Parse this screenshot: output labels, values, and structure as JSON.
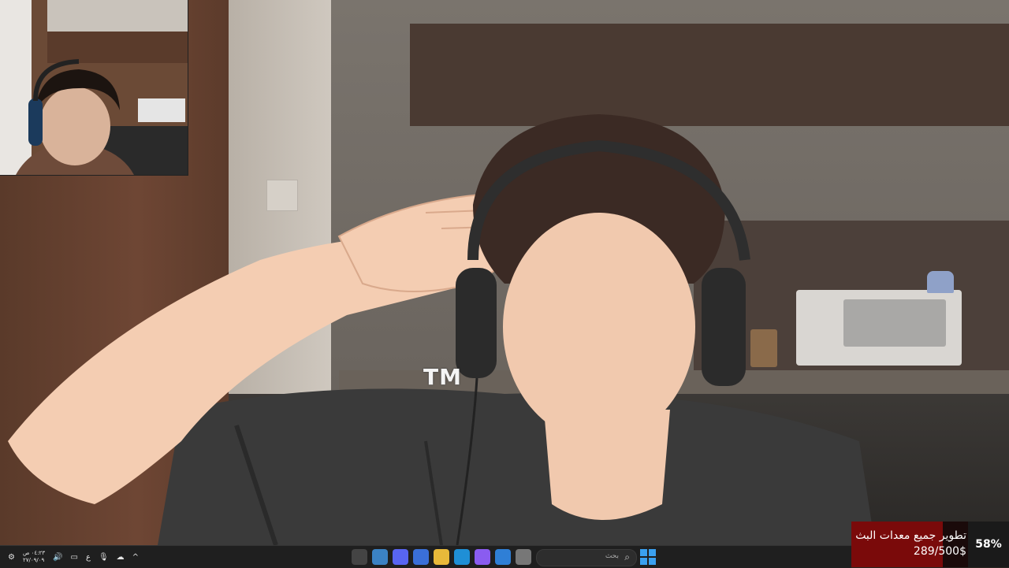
{
  "overlay": {
    "watermark": "TM"
  },
  "goal": {
    "title": "تطوير جميع معدات البث",
    "amount": "289/500$",
    "percent_label": "58%",
    "progress": 0.58,
    "fill_color": "#7a0a0a"
  },
  "taskbar": {
    "search_placeholder": "بحث",
    "clock_time": "٠٤:٢٣ ص",
    "clock_date": "٢٧/٠٩/٠٩",
    "language": "ع",
    "apps": [
      {
        "name": "obs-icon",
        "color": "#444"
      },
      {
        "name": "chrome-icon",
        "color": "#3b82c4"
      },
      {
        "name": "discord-icon",
        "color": "#5865f2"
      },
      {
        "name": "store-icon",
        "color": "#3a6fd8"
      },
      {
        "name": "file-explorer-icon",
        "color": "#e8b93a"
      },
      {
        "name": "edge-icon",
        "color": "#1f8fd6"
      },
      {
        "name": "copilot-icon",
        "color": "#8a5cf0"
      },
      {
        "name": "mail-icon",
        "color": "#2f7fd6"
      },
      {
        "name": "task-view-icon",
        "color": "#777"
      }
    ]
  }
}
